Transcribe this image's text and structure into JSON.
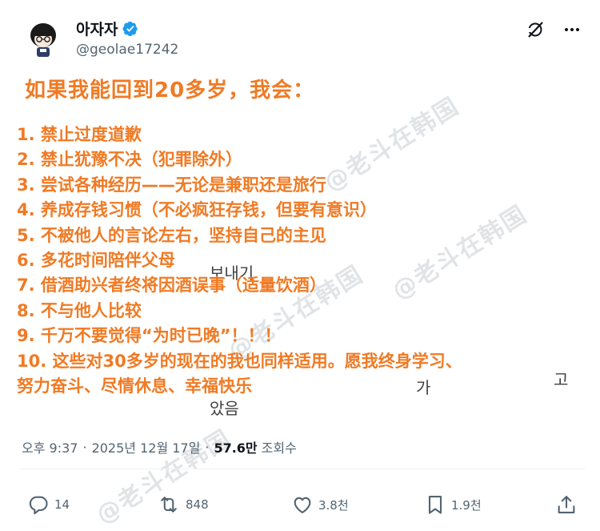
{
  "author": {
    "display_name": "아자자",
    "handle": "@geolae17242",
    "verified": true
  },
  "post": {
    "title": "如果我能回到20多岁，我会：",
    "items": [
      "1. 禁止过度道歉",
      "2. 禁止犹豫不决（犯罪除外）",
      "3. 尝试各种经历——无论是兼职还是旅行",
      "4. 养成存钱习惯（不必疯狂存钱，但要有意识）",
      "5. 不被他人的言论左右，坚持自己的主见",
      "6. 多花时间陪伴父母",
      "7. 借酒助兴者终将因酒误事（适量饮酒）",
      "8. 不与他人比较",
      "9. 千万不要觉得“为时已晚”！！！",
      "10. 这些对30多岁的现在的我也同样适用。愿我终身学习、",
      "努力奋斗、尽情休息、幸福快乐"
    ],
    "background_korean": [
      "보내기",
      "가",
      "고",
      "았음"
    ],
    "watermark": "@老斗在韩国"
  },
  "meta": {
    "time": "오후 9:37",
    "date": "2025년 12월 17일",
    "views_count": "57.6만",
    "views_label": "조회수",
    "separator": "·"
  },
  "actions": {
    "replies": "14",
    "reposts": "848",
    "likes": "3.8천",
    "bookmarks": "1.9천"
  },
  "colors": {
    "accent_text": "#f07a24",
    "verified": "#1d9bf0",
    "muted": "#536471"
  }
}
